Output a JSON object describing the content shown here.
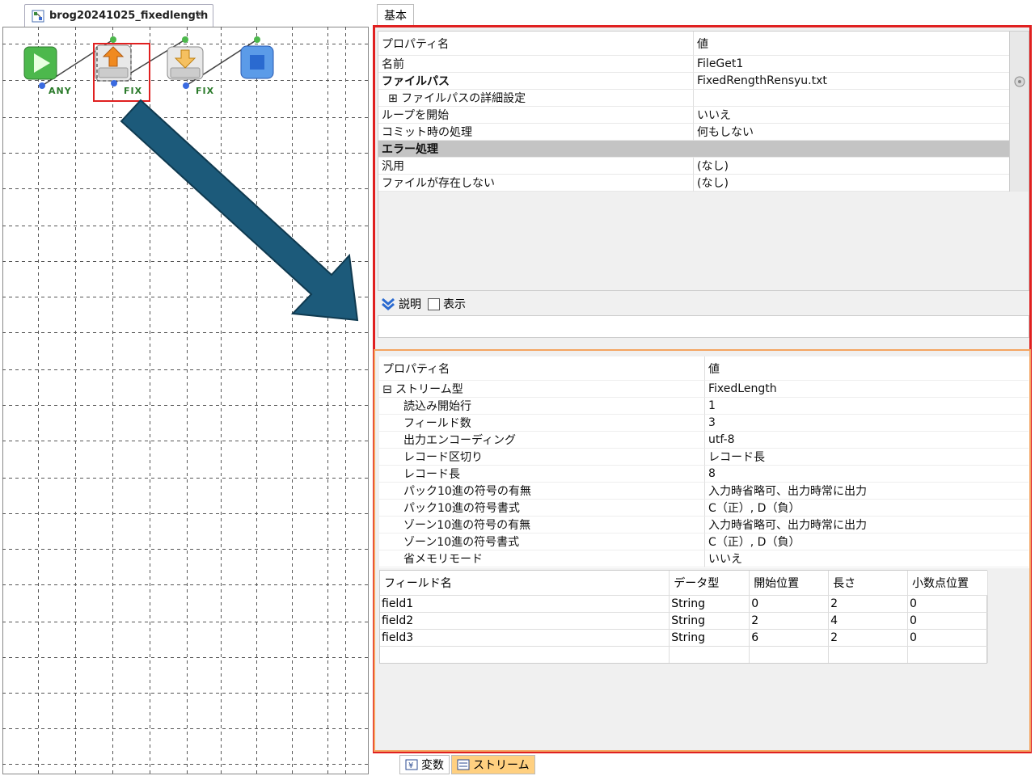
{
  "editor": {
    "tab_title": "brog20241025_fixedlength",
    "tab_close": "×",
    "nodes": [
      {
        "label": "ANY"
      },
      {
        "label": "FIX"
      },
      {
        "label": "FIX"
      }
    ]
  },
  "inspector": {
    "tab_basic": "基本",
    "header_name": "プロパティ名",
    "header_value": "値",
    "rows": [
      {
        "key": "名前",
        "value": "FileGet1"
      },
      {
        "key": "ファイルパス",
        "value": "FixedRengthRensyu.txt"
      },
      {
        "key": "⊞ ファイルパスの詳細設定",
        "value": ""
      },
      {
        "key": "ループを開始",
        "value": "いいえ"
      },
      {
        "key": "コミット時の処理",
        "value": "何もしない"
      },
      {
        "key": "エラー処理",
        "value": ""
      },
      {
        "key": "汎用",
        "value": "(なし)"
      },
      {
        "key": "ファイルが存在しない",
        "value": "(なし)"
      }
    ],
    "desc_label": "説明",
    "desc_toggle": "表示"
  },
  "stream": {
    "header_name": "プロパティ名",
    "header_value": "値",
    "rows": [
      {
        "key": "⊟ ストリーム型",
        "value": "FixedLength"
      },
      {
        "key": "読込み開始行",
        "value": "1"
      },
      {
        "key": "フィールド数",
        "value": "3"
      },
      {
        "key": "出力エンコーディング",
        "value": "utf-8"
      },
      {
        "key": "レコード区切り",
        "value": "レコード長"
      },
      {
        "key": "レコード長",
        "value": "8"
      },
      {
        "key": "パック10進の符号の有無",
        "value": "入力時省略可、出力時常に出力"
      },
      {
        "key": "パック10進の符号書式",
        "value": "C（正）, D（負）"
      },
      {
        "key": "ゾーン10進の符号の有無",
        "value": "入力時省略可、出力時常に出力"
      },
      {
        "key": "ゾーン10進の符号書式",
        "value": "C（正）, D（負）"
      },
      {
        "key": "省メモリモード",
        "value": "いいえ"
      }
    ],
    "fields": {
      "headers": [
        "フィールド名",
        "データ型",
        "開始位置",
        "長さ",
        "小数点位置"
      ],
      "rows": [
        [
          "field1",
          "String",
          "0",
          "2",
          "0"
        ],
        [
          "field2",
          "String",
          "2",
          "4",
          "0"
        ],
        [
          "field3",
          "String",
          "6",
          "2",
          "0"
        ]
      ]
    }
  },
  "bottom_tabs": {
    "variables": "変数",
    "stream": "ストリーム"
  }
}
